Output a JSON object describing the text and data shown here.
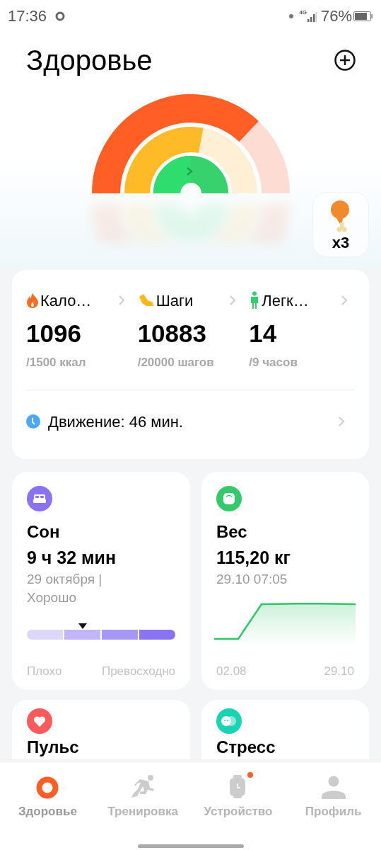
{
  "status_bar": {
    "time": "17:36",
    "network": "4G",
    "battery": "76%"
  },
  "header": {
    "title": "Здоровье"
  },
  "rings": [
    {
      "kind": "calories",
      "color": "#ff5f24"
    },
    {
      "kind": "steps",
      "color": "#ffbb27"
    },
    {
      "kind": "activity",
      "color": "#2fdc6e"
    }
  ],
  "reward": {
    "count": "x3"
  },
  "summary": {
    "stats": [
      {
        "kind": "calories",
        "label": "Кало…",
        "value": "1096",
        "goal": "/1500 ккал"
      },
      {
        "kind": "steps",
        "label": "Шаги",
        "value": "10883",
        "goal": "/20000 шагов"
      },
      {
        "kind": "activity",
        "label": "Легк…",
        "value": "14",
        "goal": "/9 часов"
      }
    ],
    "movement": "Движение: 46 мин."
  },
  "cards": [
    {
      "kind": "sleep",
      "title": "Сон",
      "value": "9 ч 32 мин",
      "detail": "29 октября | Хорошо",
      "quality_bar": {
        "kind": "sleep_quality"
      },
      "scale_labels": [
        "Плохо",
        "Превосходно"
      ]
    },
    {
      "kind": "weight",
      "title": "Вес",
      "value": "115,20 кг",
      "detail": "29.10 07:05",
      "axis_labels": [
        "02.08",
        "29.10"
      ]
    },
    {
      "kind": "pulse",
      "title": "Пульс"
    },
    {
      "kind": "stress",
      "title": "Стресс"
    }
  ],
  "nav": [
    {
      "kind": "health",
      "label": "Здоровье",
      "selected": true,
      "notification": false
    },
    {
      "kind": "workout",
      "label": "Тренировка",
      "selected": false,
      "notification": false
    },
    {
      "kind": "device",
      "label": "Устройство",
      "selected": false,
      "notification": true
    },
    {
      "kind": "profile",
      "label": "Профиль",
      "selected": false,
      "notification": false
    }
  ]
}
